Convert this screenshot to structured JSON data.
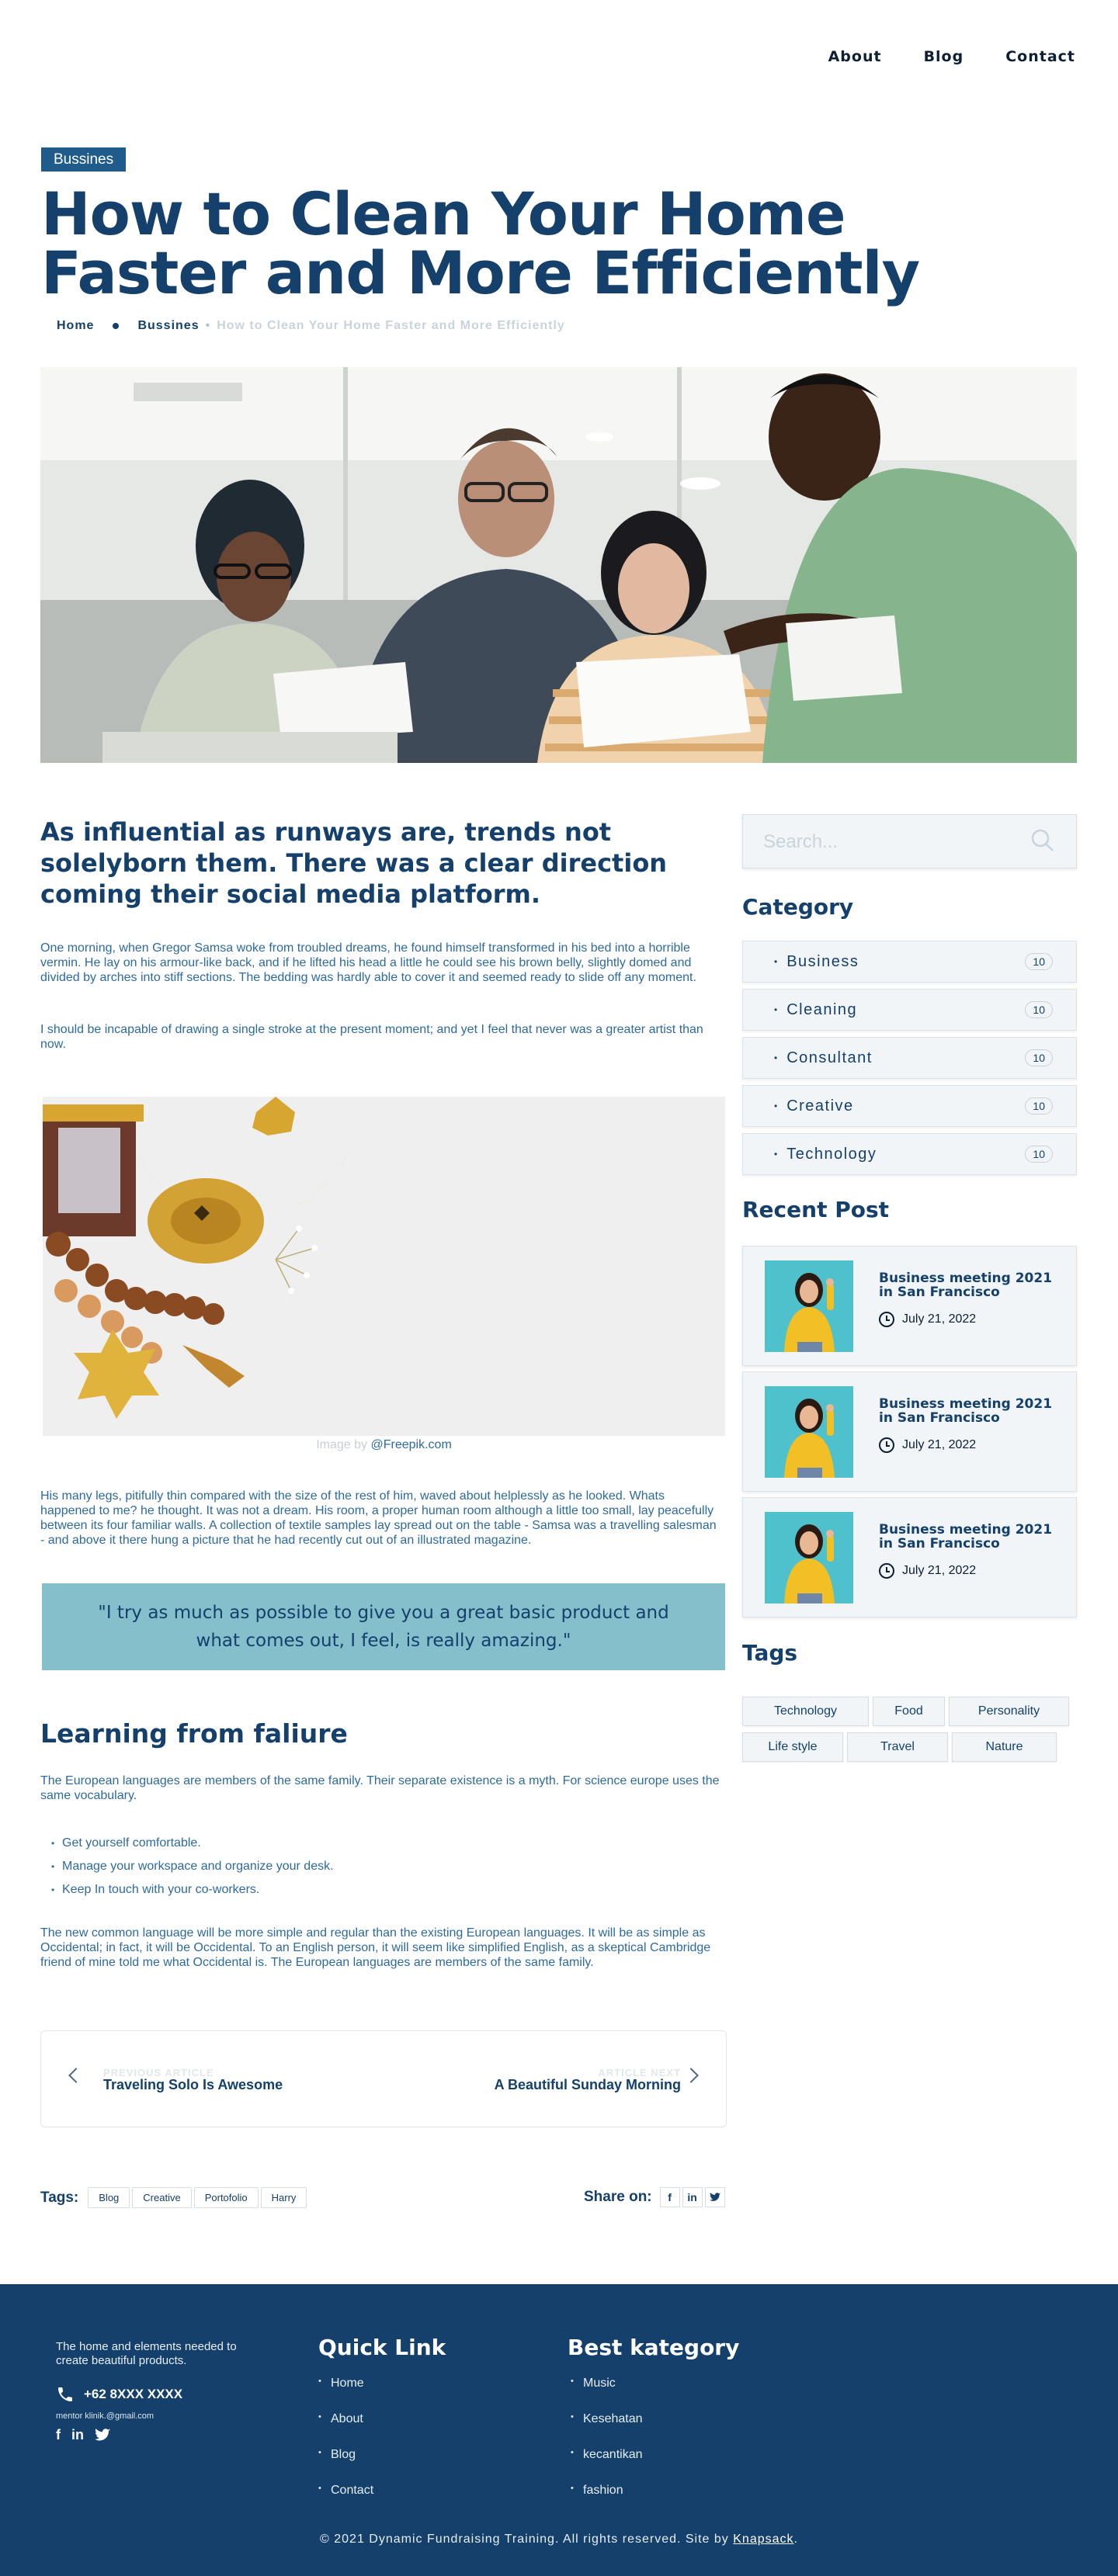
{
  "nav": {
    "items": [
      "About",
      "Blog",
      "Contact"
    ]
  },
  "article": {
    "category": "Bussines",
    "title": "How to Clean Your Home Faster and More Efficiently",
    "breadcrumb": {
      "home": "Home",
      "section": "Bussines",
      "current": "How to Clean Your Home Faster and More Efficiently"
    },
    "lead": "As influential as runways are, trends not solelyborn them. There was a clear direction coming their social media platform.",
    "p1": "One morning, when Gregor Samsa woke from troubled dreams, he found himself transformed in his bed into a horrible vermin. He lay on his armour-like back, and if he lifted his head a little he could see his brown belly, slightly domed and divided by arches into stiff sections. The bedding was hardly able to cover it and seemed ready to slide off any moment.",
    "p2": "I should be incapable of drawing a single stroke at the present moment; and yet I feel that never was a greater artist than now.",
    "caption_prefix": "Image by",
    "caption_link": "@Freepik.com",
    "p3": "His many legs, pitifully thin compared with the size of the rest of him, waved about helplessly as he looked. Whats happened to me? he thought. It was not a dream. His room, a proper human room although a little too small, lay peacefully between its four familiar walls. A collection of textile samples lay spread out on the table - Samsa was a travelling salesman - and above it there hung a picture that he had recently cut out of an illustrated magazine.",
    "quote": "\"I try as much as possible to give you a great basic product and what comes out, I feel, is really amazing.\"",
    "h2": "Learning from faliure",
    "p4": "The European languages are members of the same family. Their separate existence is a myth. For science europe uses the same vocabulary.",
    "list": [
      "Get yourself comfortable.",
      "Manage your workspace and organize your desk.",
      "Keep In touch with your co-workers."
    ],
    "p5": "The new common language will be more simple and regular than the existing European languages. It will be as simple as Occidental; in fact, it will be Occidental. To an English person, it will seem like simplified English, as a skeptical Cambridge friend of mine told me what Occidental is. The European languages are members of the same family."
  },
  "postnav": {
    "prev_label": "PREVIOUS ARTICLE",
    "prev_title": "Traveling Solo Is Awesome",
    "next_label": "ARTICLE NEXT",
    "next_title": "A Beautiful Sunday Morning"
  },
  "tags": {
    "label": "Tags:",
    "items": [
      "Blog",
      "Creative",
      "Portofolio",
      "Harry"
    ]
  },
  "share": {
    "label": "Share on:",
    "icons": [
      "facebook-icon",
      "linkedin-icon",
      "twitter-icon"
    ]
  },
  "sidebar": {
    "search_placeholder": "Search...",
    "category_title": "Category",
    "categories": [
      {
        "name": "Business",
        "count": "10"
      },
      {
        "name": "Cleaning",
        "count": "10"
      },
      {
        "name": "Consultant",
        "count": "10"
      },
      {
        "name": "Creative",
        "count": "10"
      },
      {
        "name": "Technology",
        "count": "10"
      }
    ],
    "recent_title": "Recent Post",
    "recent": [
      {
        "title": "Business meeting 2021 in San Francisco",
        "date": "July 21, 2022"
      },
      {
        "title": "Business meeting 2021 in San Francisco",
        "date": "July 21, 2022"
      },
      {
        "title": "Business meeting 2021 in San Francisco",
        "date": "July 21, 2022"
      }
    ],
    "tags_title": "Tags",
    "tags": [
      "Technology",
      "Food",
      "Personality",
      "Life style",
      "Travel",
      "Nature"
    ]
  },
  "footer": {
    "description": "The home and elements needed to create beautiful products.",
    "phone": "+62 8XXX XXXX",
    "email": "mentor klinik.@gmail.com",
    "quick_title": "Quick Link",
    "quick_links": [
      "Home",
      "About",
      "Blog",
      "Contact"
    ],
    "best_title": "Best kategory",
    "best_links": [
      "Music",
      "Kesehatan",
      "kecantikan",
      "fashion"
    ],
    "copyright": "© 2021 Dynamic Fundraising Training. All rights reserved. Site by",
    "copyright_link": "Knapsack"
  },
  "colors": {
    "navy": "#14406b",
    "badge": "#1f5c8c",
    "quote_bg": "#84bfcb",
    "footer_bg": "#14406b",
    "card_bg": "#f1f5f8"
  }
}
